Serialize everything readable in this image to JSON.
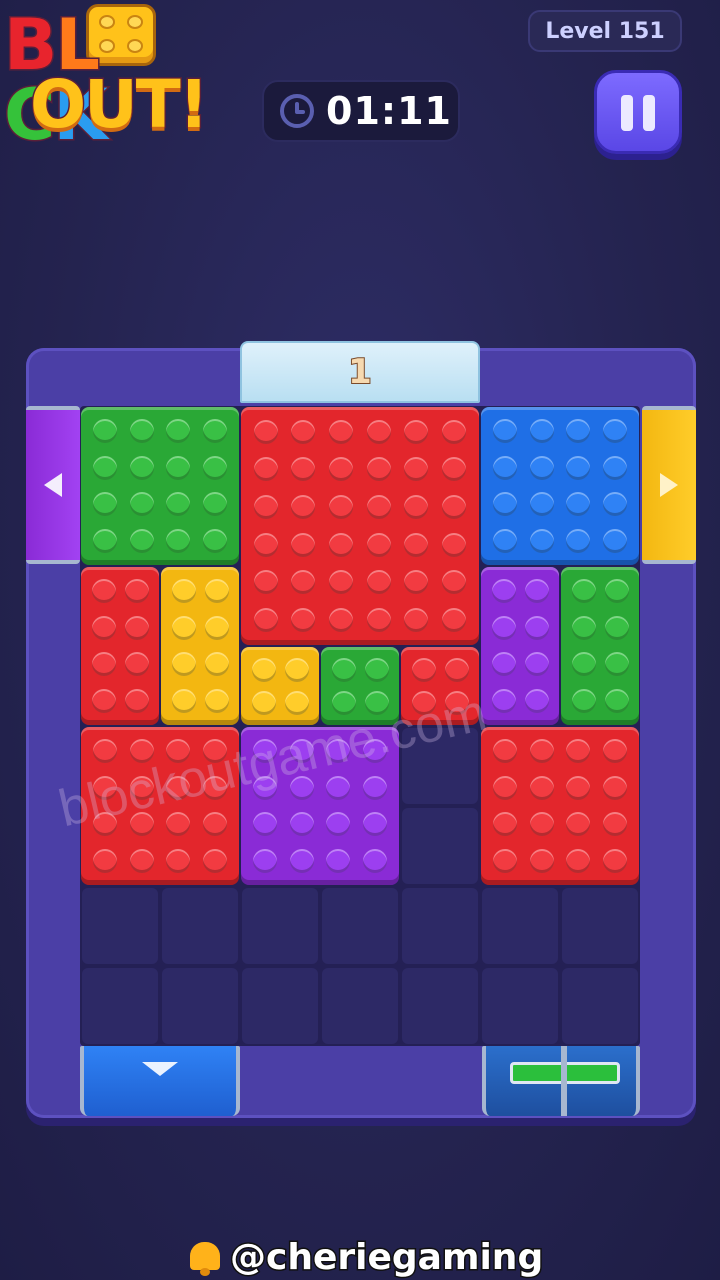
{
  "logo": {
    "line1_letters": [
      "B",
      "L",
      "",
      "C",
      "K"
    ],
    "line2": "OUT!"
  },
  "header": {
    "level": "Level 151",
    "timer": "01:11"
  },
  "gates": {
    "top": {
      "color": "#dff1fb",
      "count": "1"
    },
    "left": {
      "color": "#8a2bd6",
      "arrow": "left"
    },
    "right": {
      "color": "#f3b711",
      "arrow": "right"
    },
    "bottom_left": {
      "color": "#1f6fe6",
      "arrow": "down"
    },
    "bottom_right": {
      "color": "#2bbf3c",
      "state": "locked"
    }
  },
  "board": {
    "cols": 7,
    "rows": 8,
    "blocks": [
      {
        "color": "green",
        "col": 0,
        "row": 0,
        "w": 2,
        "h": 2
      },
      {
        "color": "red",
        "col": 2,
        "row": 0,
        "w": 3,
        "h": 3
      },
      {
        "color": "blue",
        "col": 5,
        "row": 0,
        "w": 2,
        "h": 2
      },
      {
        "color": "red",
        "col": 0,
        "row": 2,
        "w": 1,
        "h": 2
      },
      {
        "color": "yellow",
        "col": 1,
        "row": 2,
        "w": 1,
        "h": 2
      },
      {
        "color": "purple",
        "col": 5,
        "row": 2,
        "w": 1,
        "h": 2
      },
      {
        "color": "green",
        "col": 6,
        "row": 2,
        "w": 1,
        "h": 2
      },
      {
        "color": "yellow",
        "col": 2,
        "row": 3,
        "w": 1,
        "h": 1
      },
      {
        "color": "green",
        "col": 3,
        "row": 3,
        "w": 1,
        "h": 1
      },
      {
        "color": "red",
        "col": 4,
        "row": 3,
        "w": 1,
        "h": 1
      },
      {
        "color": "red",
        "col": 0,
        "row": 4,
        "w": 2,
        "h": 2
      },
      {
        "color": "purple",
        "col": 2,
        "row": 4,
        "w": 2,
        "h": 2
      },
      {
        "color": "red",
        "col": 5,
        "row": 4,
        "w": 2,
        "h": 2
      }
    ]
  },
  "watermark": "blockoutgame.com",
  "footer": {
    "handle": "@cheriegaming"
  }
}
